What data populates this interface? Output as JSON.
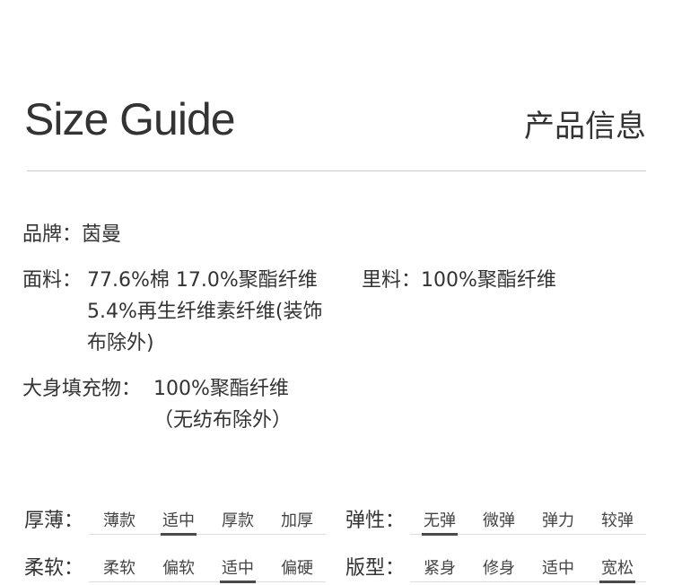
{
  "header": {
    "title_en": "Size Guide",
    "title_cn": "产品信息"
  },
  "info": {
    "brand_label": "品牌：",
    "brand_value": "茵曼",
    "fabric_label": "面料：",
    "fabric_lines": [
      "77.6%棉 17.0%聚酯纤维",
      "5.4%再生纤维素纤维(装饰",
      "布除外)"
    ],
    "lining_label": "里料：",
    "lining_value": "100%聚酯纤维",
    "filling_label": "大身填充物：",
    "filling_lines": [
      "100%聚酯纤维",
      "（无纺布除外）"
    ]
  },
  "attributes": {
    "thickness": {
      "label": "厚薄：",
      "options": [
        "薄款",
        "适中",
        "厚款",
        "加厚"
      ],
      "selected": "适中"
    },
    "elasticity": {
      "label": "弹性：",
      "options": [
        "无弹",
        "微弹",
        "弹力",
        "较弹"
      ],
      "selected": "无弹"
    },
    "softness": {
      "label": "柔软：",
      "options": [
        "柔软",
        "偏软",
        "适中",
        "偏硬"
      ],
      "selected": "适中"
    },
    "fit": {
      "label": "版型：",
      "options": [
        "紧身",
        "修身",
        "适中",
        "宽松"
      ],
      "selected": "宽松"
    }
  }
}
